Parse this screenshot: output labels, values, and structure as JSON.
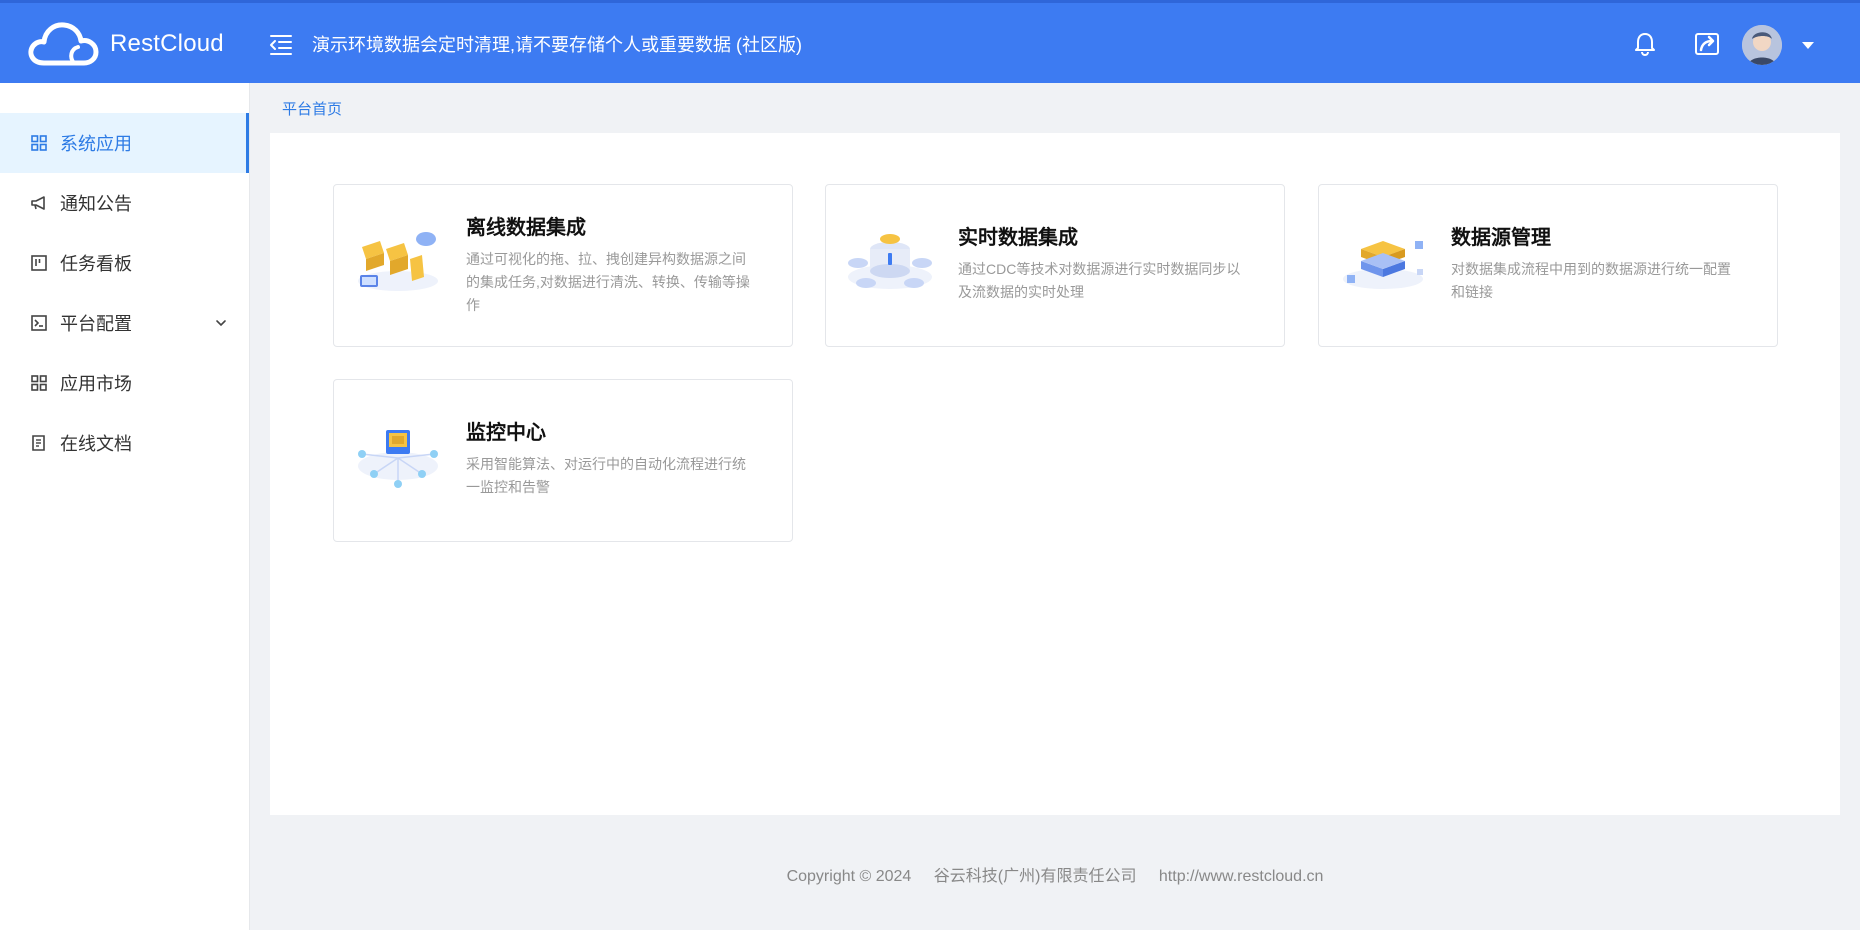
{
  "header": {
    "brand": "RestCloud",
    "notice": "演示环境数据会定时清理,请不要存储个人或重要数据 (社区版)",
    "bg_color": "#3d7bf2"
  },
  "sidebar": {
    "items": [
      {
        "label": "系统应用",
        "icon": "grid-icon",
        "active": true
      },
      {
        "label": "通知公告",
        "icon": "megaphone-icon",
        "active": false
      },
      {
        "label": "任务看板",
        "icon": "kanban-icon",
        "active": false
      },
      {
        "label": "平台配置",
        "icon": "terminal-icon",
        "active": false,
        "expandable": true
      },
      {
        "label": "应用市场",
        "icon": "grid-icon",
        "active": false
      },
      {
        "label": "在线文档",
        "icon": "document-icon",
        "active": false
      }
    ],
    "active_color": "#2d7be5"
  },
  "breadcrumb": "平台首页",
  "cards": [
    {
      "title": "离线数据集成",
      "desc": "通过可视化的拖、拉、拽创建异构数据源之间的集成任务,对数据进行清洗、转换、传输等操作"
    },
    {
      "title": "实时数据集成",
      "desc": "通过CDC等技术对数据源进行实时数据同步以及流数据的实时处理"
    },
    {
      "title": "数据源管理",
      "desc": "对数据集成流程中用到的数据源进行统一配置和链接"
    },
    {
      "title": "监控中心",
      "desc": "采用智能算法、对运行中的自动化流程进行统一监控和告警"
    }
  ],
  "footer": {
    "copyright": "Copyright © 2024",
    "company": "谷云科技(广州)有限责任公司",
    "url": "http://www.restcloud.cn"
  }
}
